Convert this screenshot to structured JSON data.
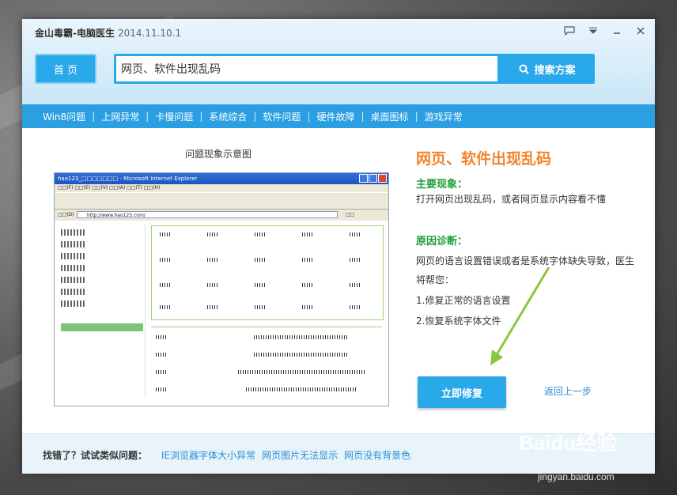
{
  "window": {
    "app_title": "金山毒霸-电脑医生",
    "version": "2014.11.10.1"
  },
  "controls": {
    "feedback_icon": "chat-bubble-icon",
    "menu_icon": "dropdown-menu-icon",
    "minimize_icon": "minimize-icon",
    "close_icon": "close-icon"
  },
  "toolbar": {
    "home_label": "首 页",
    "search_value": "网页、软件出现乱码",
    "search_button_label": "搜索方案",
    "search_icon": "search-icon"
  },
  "nav": {
    "items": [
      "Win8问题",
      "上网异常",
      "卡慢问题",
      "系统综合",
      "软件问题",
      "硬件故障",
      "桌面图标",
      "游戏异常"
    ]
  },
  "preview": {
    "caption": "问题现象示意图",
    "ie_title": "hao123_□□□□□□□ - Microsoft Internet Explorer",
    "ie_menu": "□□(F)  □□(E)  □□(V)  □□(A)  □□(T)  □□(H)",
    "ie_address_label": "□□(D)",
    "ie_url": "http://www.hao123.com/",
    "ie_go": "□□"
  },
  "result": {
    "title": "网页、软件出现乱码",
    "symptom_heading": "主要现象：",
    "symptom_text": "打开网页出现乱码，或者网页显示内容看不懂",
    "diagnosis_heading": "原因诊断：",
    "diagnosis_text": "网页的语言设置错误或者是系统字体缺失导致，医生将帮您：",
    "steps": [
      "1.修复正常的语言设置",
      "2.恢复系统字体文件"
    ],
    "fix_button": "立即修复",
    "back_link": "返回上一步"
  },
  "footer": {
    "label": "找错了？试试类似问题：",
    "links": [
      "IE浏览器字体大小异常",
      "网页图片无法显示",
      "网页没有背景色"
    ]
  },
  "watermark": {
    "logo": "Baidu经验",
    "url": "jingyan.baidu.com"
  },
  "colors": {
    "accent": "#29a8ea",
    "nav_bar": "#2a9fe2",
    "title_orange": "#f2832c",
    "heading_green": "#1f9e3a",
    "link_blue": "#2a8fd8"
  }
}
